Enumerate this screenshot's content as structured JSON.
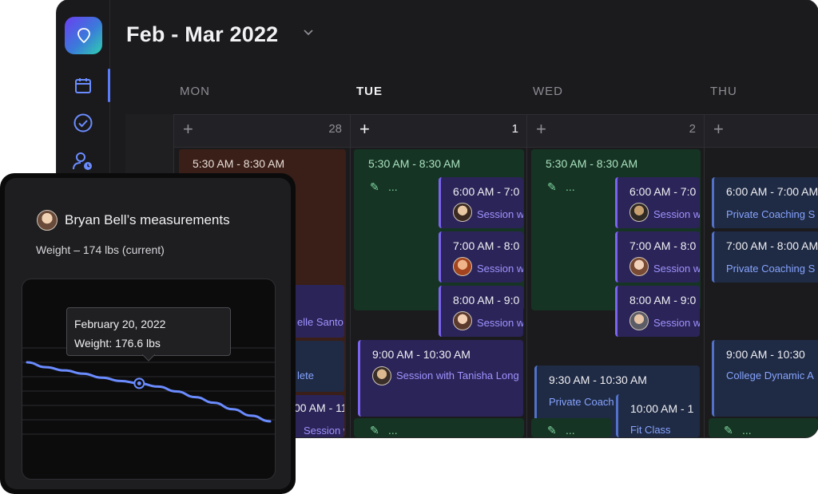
{
  "header": {
    "title": "Feb - Mar 2022"
  },
  "sidebar": {
    "items": [
      "calendar-icon",
      "check-circle-icon",
      "user-clock-icon"
    ]
  },
  "days": [
    {
      "label": "MON",
      "num": "28"
    },
    {
      "label": "TUE",
      "num": "1"
    },
    {
      "label": "WED",
      "num": "2"
    },
    {
      "label": "THU",
      "num": ""
    }
  ],
  "blocks": {
    "mon_time": "5:30 AM - 8:30 AM",
    "tue_time": "5:30 AM - 8:30 AM",
    "wed_time": "5:30 AM - 8:30 AM",
    "dots": "..."
  },
  "events": {
    "mon_session": "elle Santo",
    "mon_lete": "lete",
    "mon_1100": "00 AM - 11",
    "mon_sess2": "Session w",
    "tue_600": "6:00 AM - 7:0",
    "tue_700": "7:00 AM - 8:0",
    "tue_800": "8:00 AM - 9:0",
    "tue_sess": "Session w",
    "tue_900": "9:00 AM - 10:30 AM",
    "tue_900_sub": "Session with Tanisha Long",
    "wed_600": "6:00 AM - 7:0",
    "wed_700": "7:00 AM - 8:0",
    "wed_800": "8:00 AM - 9:0",
    "wed_sess": "Session w",
    "wed_930": "9:30 AM - 10:30 AM",
    "wed_930_sub": "Private Coach",
    "wed_1000": "10:00 AM - 1",
    "wed_1000_sub": "Fit Class",
    "thu_600": "6:00 AM - 7:00 AM",
    "thu_700": "7:00 AM - 8:00 AM",
    "thu_pc": "Private Coaching S",
    "thu_900": "9:00 AM - 10:30",
    "thu_900_sub": "College Dynamic A"
  },
  "panel": {
    "title": "Bryan Bell’s measurements",
    "weight": "Weight – 174 lbs (current)",
    "tooltip_date": "February 20, 2022",
    "tooltip_value": "Weight: 176.6 lbs"
  },
  "chart_data": {
    "type": "line",
    "series": [
      {
        "values": [
          179.2,
          178.6,
          178.2,
          177.8,
          177.3,
          176.9,
          176.6,
          176.2,
          175.6,
          174.9,
          174.2,
          173.4,
          172.6,
          171.9
        ]
      }
    ],
    "highlight_index": 6,
    "line_color": "#6b8cff"
  }
}
